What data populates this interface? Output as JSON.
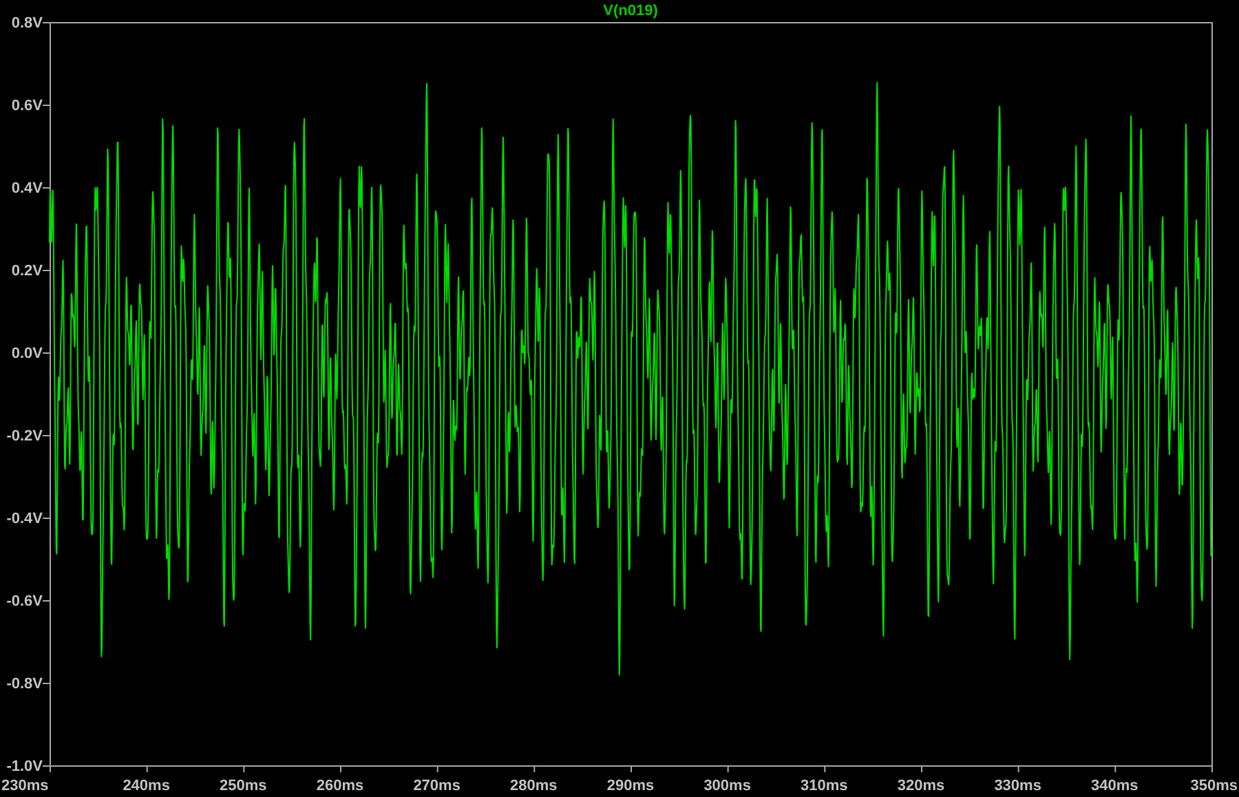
{
  "plot": {
    "trace_label": "V(n019)",
    "y_tick_labels": [
      "0.8V",
      "0.6V",
      "0.4V",
      "0.2V",
      "0.0V",
      "-0.2V",
      "-0.4V",
      "-0.6V",
      "-0.8V",
      "-1.0V"
    ],
    "x_tick_labels": [
      "230ms",
      "240ms",
      "250ms",
      "260ms",
      "270ms",
      "280ms",
      "290ms",
      "300ms",
      "310ms",
      "320ms",
      "330ms",
      "340ms",
      "350ms"
    ]
  }
}
